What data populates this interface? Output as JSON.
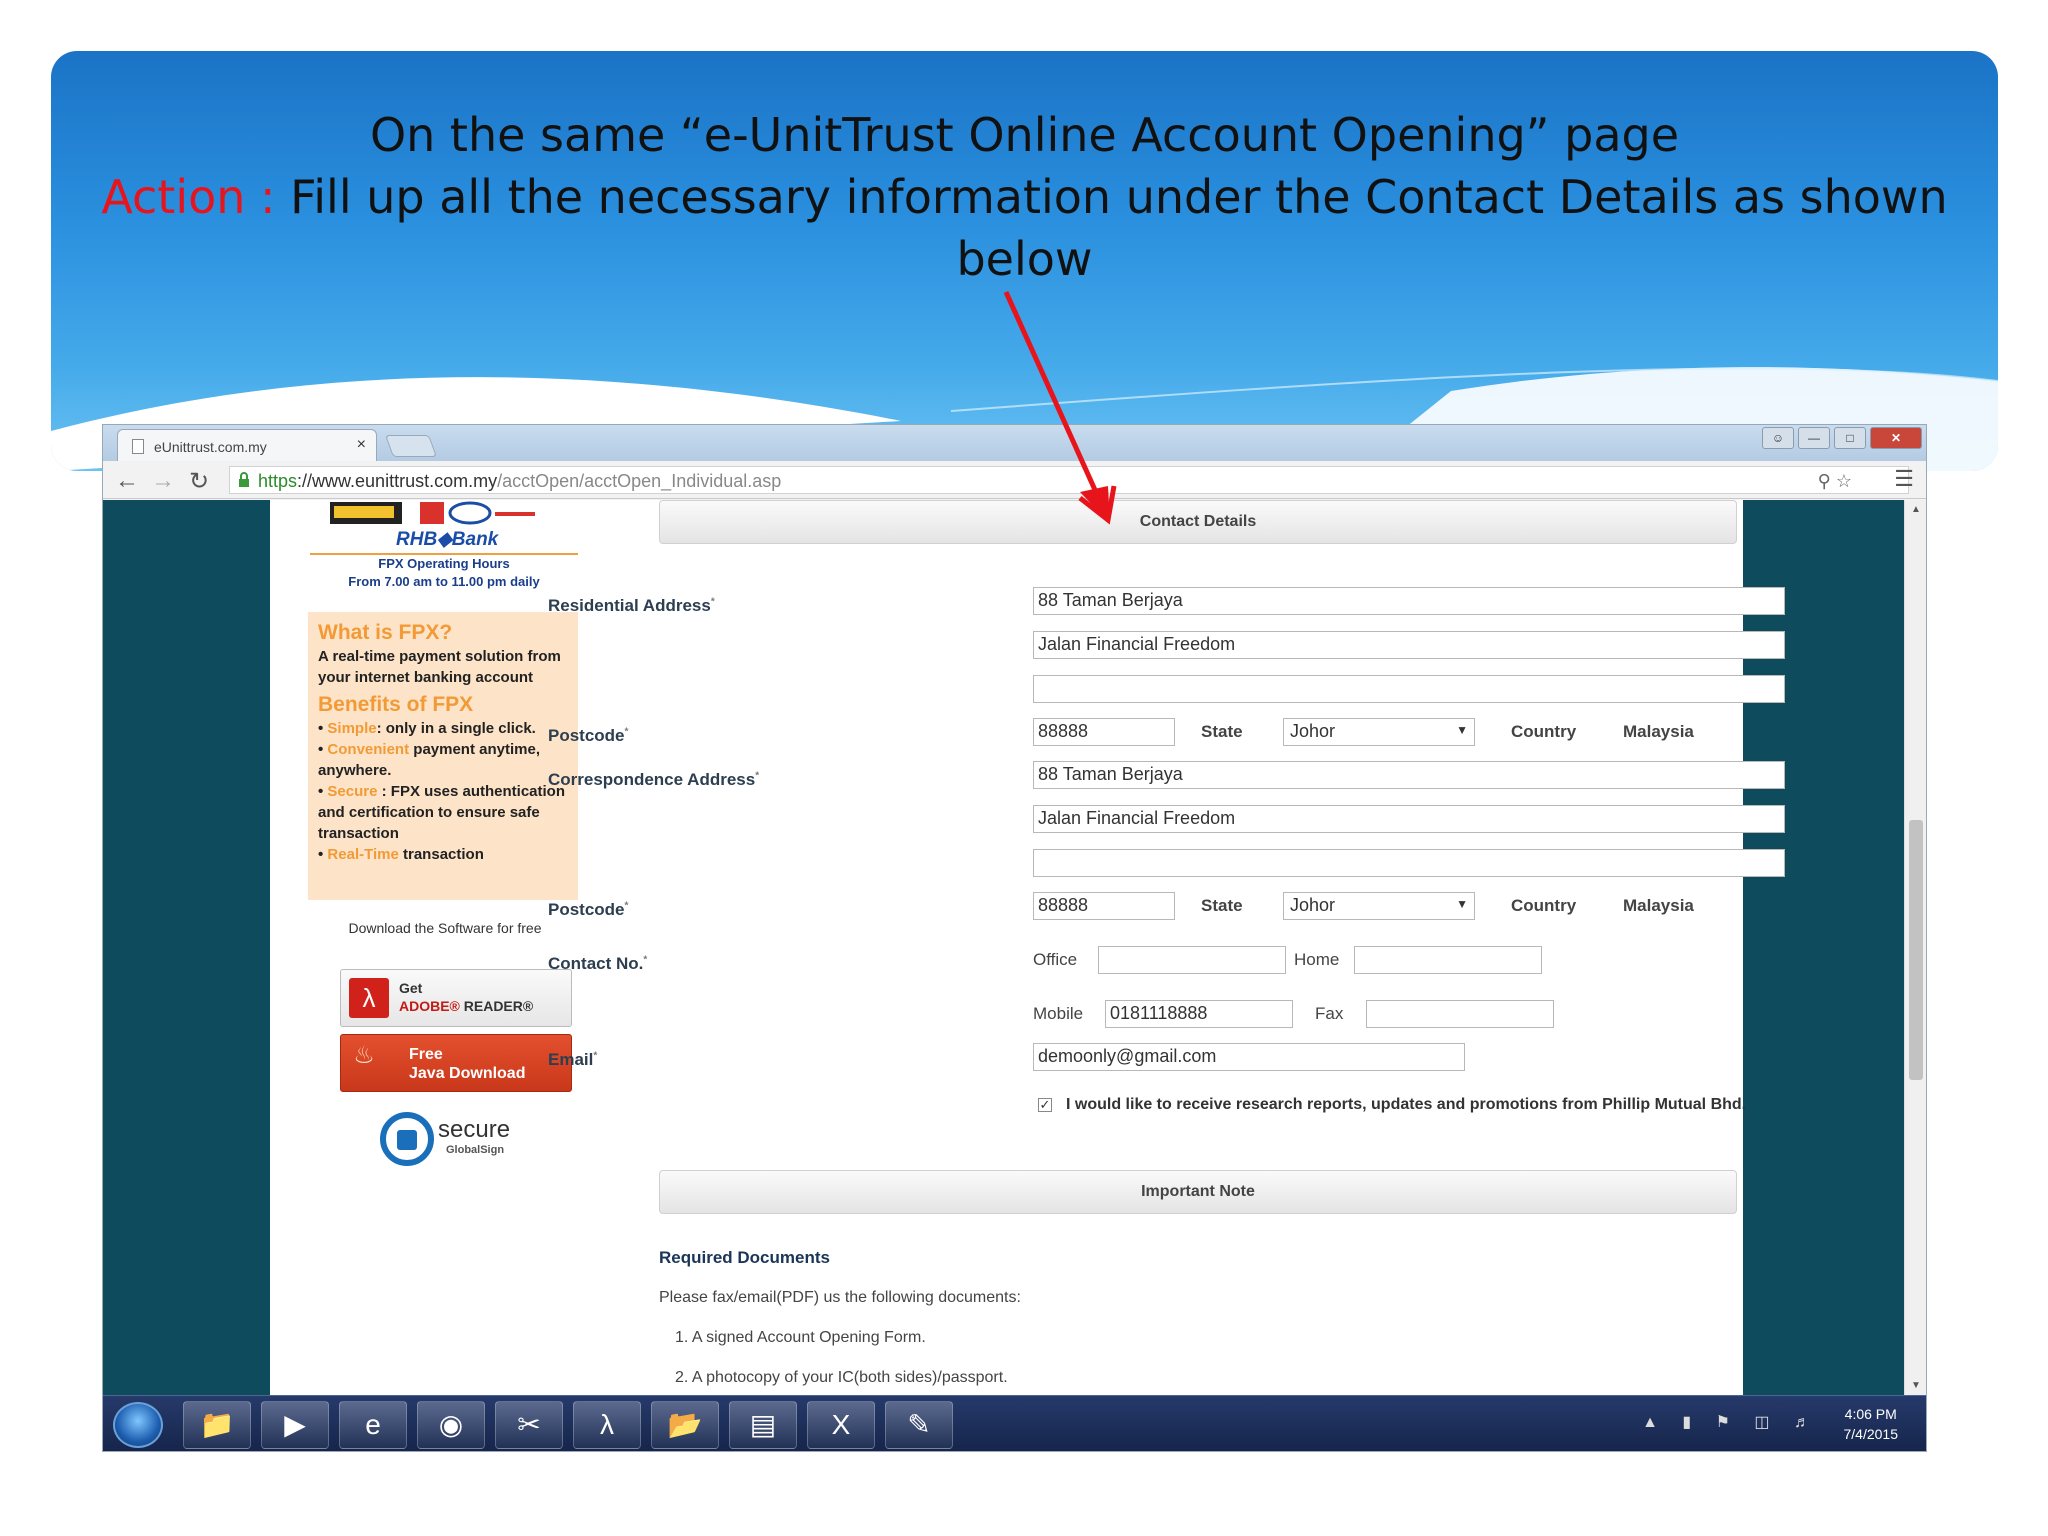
{
  "slide": {
    "title_line": "On the same “e-UnitTrust Online Account Opening” page",
    "action_label": "Action :",
    "action_text": "Fill up all the necessary information under the Contact Details as shown below"
  },
  "browser": {
    "tab_title": "eUnittrust.com.my",
    "tab_close": "×",
    "url_https": "https",
    "url_host": "://www.eunittrust.com.my",
    "url_path": "/acctOpen/acctOpen_Individual.asp"
  },
  "sidebar": {
    "rhb_logo": "RHB◆Bank",
    "fpx_hours_title": "FPX Operating Hours",
    "fpx_hours_time": "From 7.00 am to 11.00 pm daily",
    "what_is_fpx": "What is FPX?",
    "fpx_desc": "A real-time payment solution from your internet banking account",
    "benefits_title": "Benefits of FPX",
    "benefits": [
      {
        "key": "Simple",
        "text": ": only in a single click."
      },
      {
        "key": "Convenient",
        "text": " payment anytime, anywhere."
      },
      {
        "key": "Secure",
        "text": " : FPX uses authentication and certification to ensure safe transaction"
      },
      {
        "key": "Real-Time",
        "text": " transaction"
      }
    ],
    "download_text": "Download the Software for free",
    "adobe_line1": "Get",
    "adobe_brand": "ADOBE®",
    "adobe_reader": "READER®",
    "java_line1": "Free",
    "java_line2": "Java Download",
    "secure_text": "secure",
    "secure_sub": "GlobalSign"
  },
  "form": {
    "contact_section_title": "Contact Details",
    "residential_label": "Residential Address",
    "residential_lines": [
      "88 Taman Berjaya",
      "Jalan Financial Freedom",
      ""
    ],
    "postcode_label": "Postcode",
    "res_postcode": "88888",
    "state_label": "State",
    "res_state": "Johor",
    "country_label": "Country",
    "res_country": "Malaysia",
    "correspondence_label": "Correspondence Address",
    "corr_lines": [
      "88 Taman Berjaya",
      "Jalan Financial Freedom",
      ""
    ],
    "corr_postcode": "88888",
    "corr_state": "Johor",
    "corr_country": "Malaysia",
    "contact_label": "Contact No.",
    "office_label": "Office",
    "office_value": "",
    "home_label": "Home",
    "home_value": "",
    "mobile_label": "Mobile",
    "mobile_value": "0181118888",
    "fax_label": "Fax",
    "fax_value": "",
    "email_label": "Email",
    "email_value": "demoonly@gmail.com",
    "consent_checked": true,
    "consent_text": "I would like to receive research reports, updates and promotions from Phillip Mutual Bhd.",
    "important_section_title": "Important Note",
    "required_docs_title": "Required Documents",
    "required_docs_intro": "Please fax/email(PDF) us the following documents:",
    "required_docs": [
      "1. A signed Account Opening Form.",
      "2. A photocopy of your IC(both sides)/passport."
    ]
  },
  "taskbar": {
    "time": "4:06 PM",
    "date": "7/4/2015"
  },
  "colors": {
    "action": "#e8141c",
    "arrow": "#e8141c",
    "banner": "#2a8fde",
    "page_bg": "#0e4b5c"
  }
}
